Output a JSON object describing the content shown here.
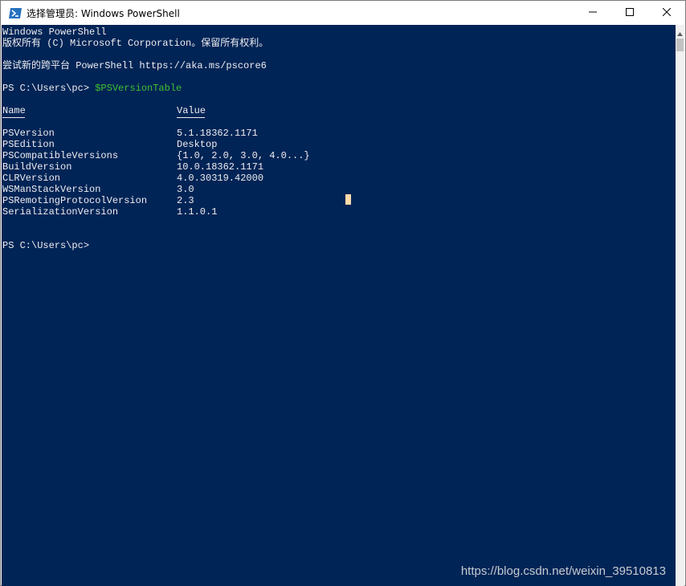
{
  "window": {
    "title": "选择管理员: Windows PowerShell",
    "icon": "powershell-icon",
    "buttons": {
      "minimize": "—",
      "maximize": "☐",
      "close": "✕"
    }
  },
  "console": {
    "banner_line1": "Windows PowerShell",
    "banner_line2": "版权所有 (C) Microsoft Corporation。保留所有权利。",
    "banner_line3": "尝试新的跨平台 PowerShell https://aka.ms/pscore6",
    "prompt1": "PS C:\\Users\\pc> ",
    "command": "$PSVersionTable",
    "table": {
      "headers": [
        "Name",
        "Value"
      ],
      "rows": [
        {
          "name": "PSVersion",
          "value": "5.1.18362.1171"
        },
        {
          "name": "PSEdition",
          "value": "Desktop"
        },
        {
          "name": "PSCompatibleVersions",
          "value": "{1.0, 2.0, 3.0, 4.0...}"
        },
        {
          "name": "BuildVersion",
          "value": "10.0.18362.1171"
        },
        {
          "name": "CLRVersion",
          "value": "4.0.30319.42000"
        },
        {
          "name": "WSManStackVersion",
          "value": "3.0"
        },
        {
          "name": "PSRemotingProtocolVersion",
          "value": "2.3"
        },
        {
          "name": "SerializationVersion",
          "value": "1.1.0.1"
        }
      ]
    },
    "prompt2": "PS C:\\Users\\pc>"
  },
  "colors": {
    "background": "#012456",
    "text": "#eeedf0",
    "command": "#3ec12f",
    "cursor": "#fedba9"
  },
  "watermark": "https://blog.csdn.net/weixin_39510813"
}
